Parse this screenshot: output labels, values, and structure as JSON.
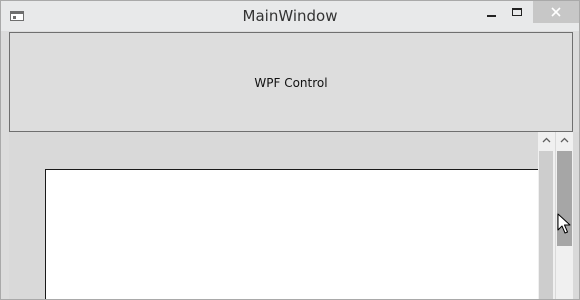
{
  "window": {
    "title": "MainWindow"
  },
  "wpf_control": {
    "label": "WPF Control"
  },
  "icons": {
    "app": "app-window-icon",
    "minimize": "minimize-icon",
    "maximize": "maximize-icon",
    "close": "close-icon",
    "scroll_up": "chevron-up-icon",
    "cursor": "mouse-pointer-icon"
  },
  "colors": {
    "close_button_bg": "#c7c7c7",
    "scroll_thumb_active": "#a6a6a6",
    "scroll_thumb_inactive": "#cdcdcd",
    "scroll_track": "#f0f0f0"
  }
}
